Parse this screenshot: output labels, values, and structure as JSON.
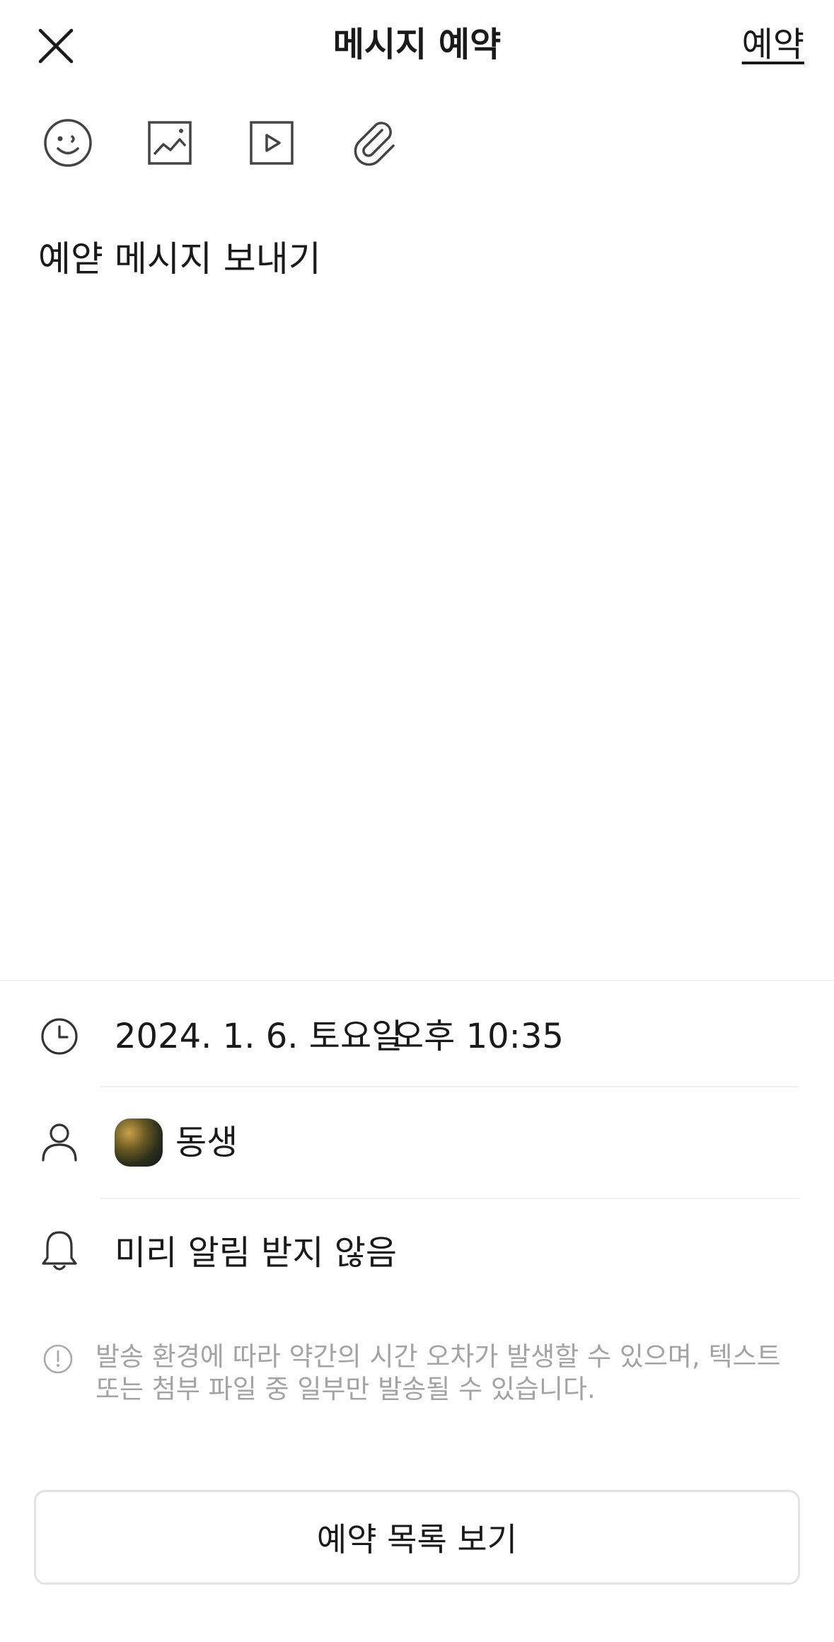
{
  "header": {
    "title": "메시지 예약",
    "submit_label": "예약"
  },
  "toolbar": {
    "icons": [
      "emoticon-icon",
      "image-icon",
      "video-icon",
      "attachment-icon"
    ]
  },
  "message": {
    "text": "예얃 메시지 보내기"
  },
  "schedule": {
    "date": "2024. 1. 6. 토요일",
    "time": "오후 10:35"
  },
  "recipient": {
    "name": "동생"
  },
  "reminder": {
    "label": "미리 알림 받지 않음"
  },
  "notice": {
    "text": "발송 환경에 따라 약간의 시간 오차가 발생할 수 있으며, 텍스트 또는 첨부 파일 중 일부만 발송될 수 있습니다."
  },
  "footer": {
    "list_button_label": "예약 목록 보기"
  },
  "colors": {
    "text": "#1a1a1a",
    "muted": "#a3a3a3",
    "icon": "#444444",
    "divider": "#f1f1f1",
    "button_border": "#e3e3e3"
  }
}
